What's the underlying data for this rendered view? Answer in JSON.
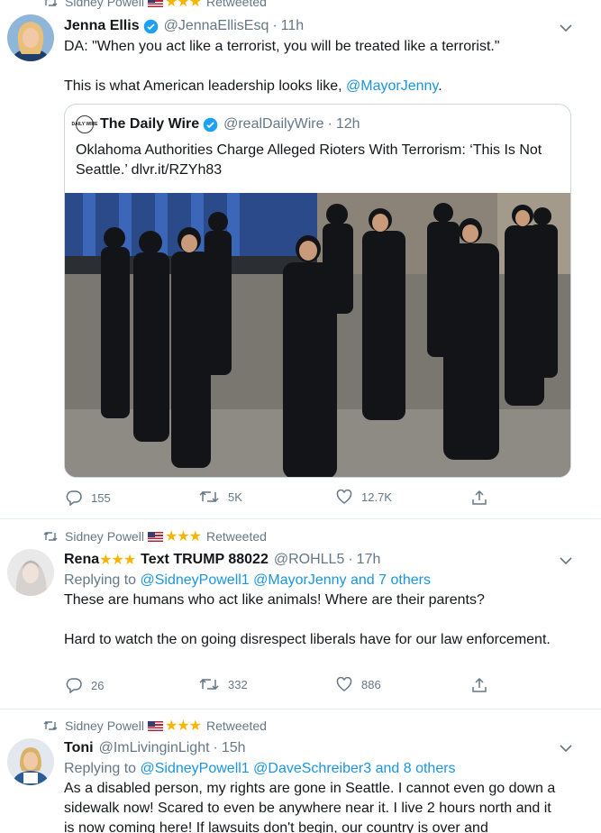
{
  "tweets": [
    {
      "retweeter": "Sidney Powell",
      "retweeted_label": "Retweeted",
      "display_name": "Jenna Ellis",
      "handle": "@JennaEllisEsq",
      "time": "11h",
      "text_line1": "DA: \"When you act like a terrorist, you will be treated like a terrorist.\"",
      "text_line2": "This is what American leadership looks like,",
      "text_mention": "@MayorJenny",
      "text_end": ".",
      "quote": {
        "name": "The Daily Wire",
        "handle": "@realDailyWire",
        "time": "12h",
        "logo_text": "DAILY WIRE",
        "text": "Oklahoma Authorities Charge Alleged Rioters With Terrorism: ‘This Is Not Seattle.’ dlvr.it/RZYh83"
      },
      "replies": "155",
      "retweets": "5K",
      "likes": "12.7K"
    },
    {
      "retweeter": "Sidney Powell",
      "retweeted_label": "Retweeted",
      "display_name_a": "Rena",
      "display_name_b": "Text TRUMP 88022",
      "handle": "@ROHLL5",
      "time": "17h",
      "replying_prefix": "Replying to",
      "replying_mention1": "@SidneyPowell1",
      "replying_mention2": "@MayorJenny",
      "replying_and": "and",
      "replying_others": "7 others",
      "text_line1": "These are humans who act like animals! Where are their parents?",
      "text_line2": "Hard to watch the on going disrespect liberals have for our law enforcement.",
      "replies": "26",
      "retweets": "332",
      "likes": "886"
    },
    {
      "retweeter": "Sidney Powell",
      "retweeted_label": "Retweeted",
      "display_name": "Toni",
      "handle": "@ImLivinginLight",
      "time": "15h",
      "replying_prefix": "Replying to",
      "replying_mention1": "@SidneyPowell1",
      "replying_mention2": "@DaveSchreiber3",
      "replying_and": "and",
      "replying_others": "8 others",
      "text": "As a disabled person, my rights are gone in Seattle. I cannot even go down a sidewalk now! Scared to even be anywhere near it. I live 2 hours north and it is now coming here! If lawsuits don't begin, our country is over and"
    }
  ],
  "stars": "★★★",
  "dot": "·",
  "colors": {
    "link": "#1b95e0",
    "muted": "#657786",
    "star": "#f7b500",
    "verified": "#1da1f2"
  }
}
